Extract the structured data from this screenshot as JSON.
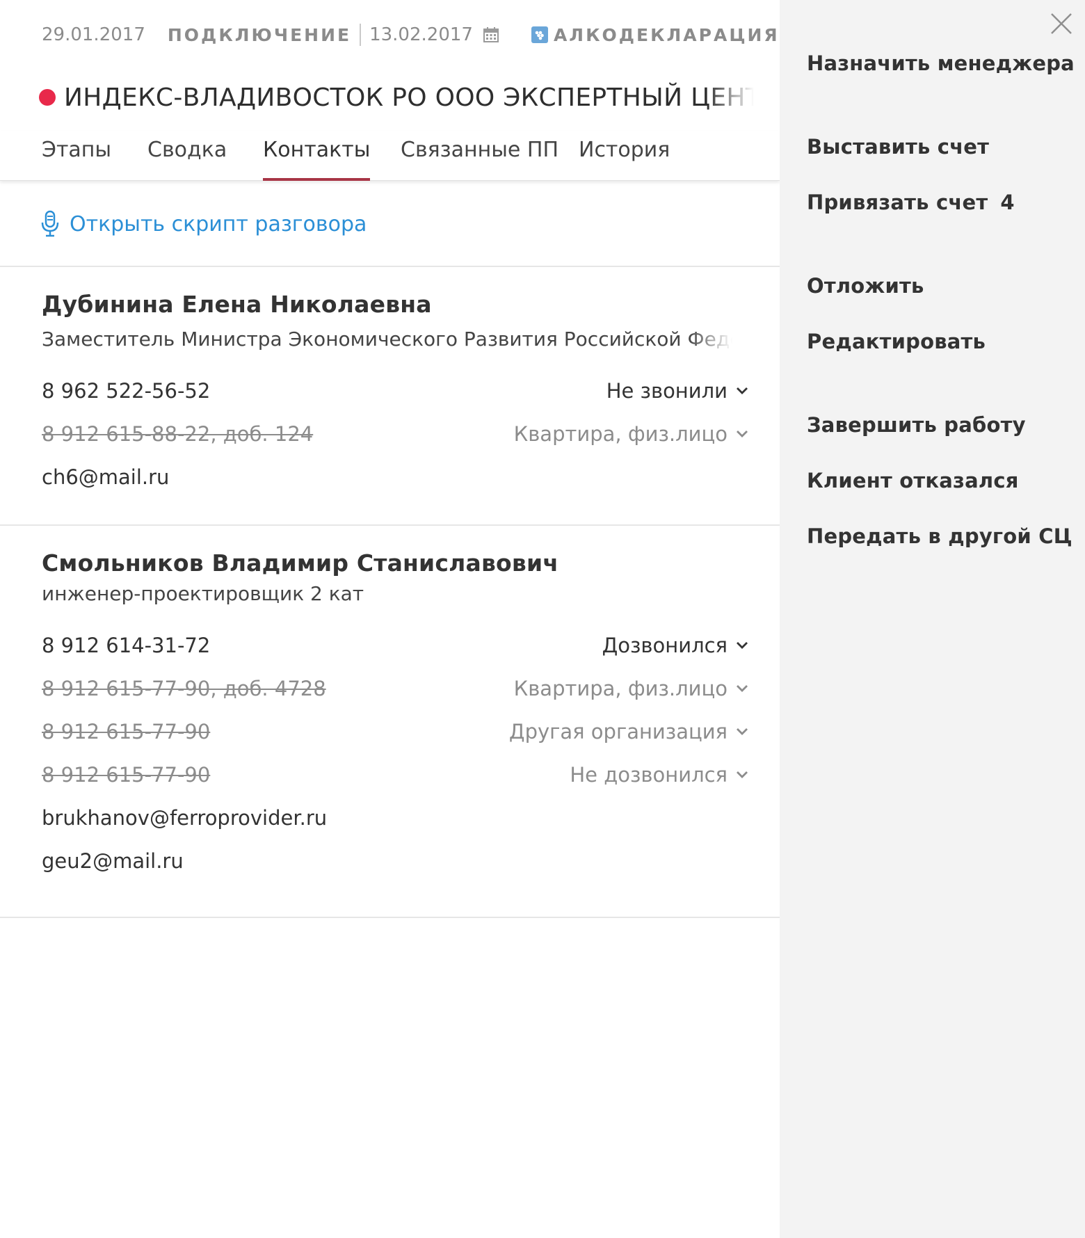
{
  "header": {
    "date_start": "29.01.2017",
    "stage": "ПОДКЛЮЧЕНИЕ",
    "date_end": "13.02.2017",
    "product": "АЛКОДЕКЛАРАЦИЯ",
    "status_color": "#e8294a",
    "company_name": "ИНДЕКС-ВЛАДИВОСТОК РО ООО ЭКСПЕРТНЫЙ ЦЕНТР ИН"
  },
  "tabs": [
    {
      "label": "Этапы"
    },
    {
      "label": "Сводка"
    },
    {
      "label": "Контакты",
      "active": true
    },
    {
      "label": "Связанные ПП"
    },
    {
      "label": "История"
    }
  ],
  "script_link": "Открыть скрипт разговора",
  "contacts": [
    {
      "name": "Дубинина Елена Николаевна",
      "position": "Заместитель Министра Экономического Развития Российской Феде",
      "phones": [
        {
          "number": "8 962 522-56-52",
          "status": "Не звонили",
          "struck": false
        },
        {
          "number": "8 912 615-88-22, доб. 124",
          "status": "Квартира, физ.лицо",
          "struck": true
        }
      ],
      "emails": [
        "ch6@mail.ru"
      ]
    },
    {
      "name": "Смольников Владимир Станиславович",
      "position": "инженер-проектировщик 2 кат",
      "phones": [
        {
          "number": "8 912 614-31-72",
          "status": "Дозвонился",
          "struck": false
        },
        {
          "number": "8 912 615-77-90, доб. 4728",
          "status": "Квартира, физ.лицо",
          "struck": true
        },
        {
          "number": "8 912 615-77-90",
          "status": "Другая организация",
          "struck": true
        },
        {
          "number": "8 912 615-77-90",
          "status": "Не дозвонился",
          "struck": true
        }
      ],
      "emails": [
        "brukhanov@ferroprovider.ru",
        "geu2@mail.ru"
      ]
    }
  ],
  "actions": {
    "assign_manager": "Назначить менеджера",
    "issue_invoice": "Выставить счет",
    "link_invoice": "Привязать счет",
    "link_invoice_count": "4",
    "postpone": "Отложить",
    "edit": "Редактировать",
    "finish": "Завершить работу",
    "client_refused": "Клиент отказался",
    "transfer": "Передать в другой СЦ"
  },
  "colors": {
    "accent_link": "#2b8fd6",
    "tab_underline": "#a83546",
    "sidebar_bg": "#f3f3f3"
  }
}
